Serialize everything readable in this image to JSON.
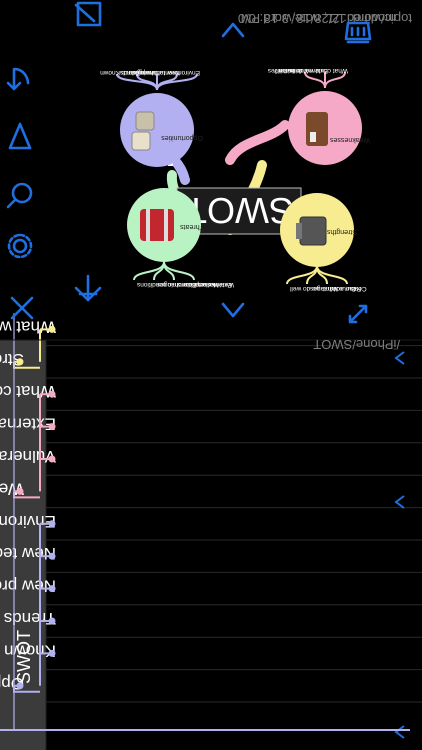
{
  "header": {
    "title": "SWOT"
  },
  "outline": {
    "items": [
      {
        "label": "Opportunities",
        "level": 1,
        "branch": "purple"
      },
      {
        "label": "Known",
        "level": 2,
        "branch": "purple"
      },
      {
        "label": "Trends",
        "level": 2,
        "branch": "purple"
      },
      {
        "label": "New products",
        "level": 2,
        "branch": "purple"
      },
      {
        "label": "New technologies",
        "level": 2,
        "branch": "purple"
      },
      {
        "label": "Environmental changes",
        "level": 2,
        "branch": "purple"
      },
      {
        "label": "Weaknesses",
        "level": 1,
        "branch": "pink"
      },
      {
        "label": "Vulnerabilities",
        "level": 2,
        "branch": "pink"
      },
      {
        "label": "External criticism",
        "level": 2,
        "branch": "pink"
      },
      {
        "label": "What could we do better?",
        "level": 2,
        "branch": "pink"
      },
      {
        "label": "Strengths",
        "level": 1,
        "branch": "yellow"
      },
      {
        "label": "What we do well",
        "level": 2,
        "branch": "yellow"
      }
    ]
  },
  "map": {
    "central": "SWOT",
    "nodes": {
      "opportunities": {
        "label": "Opportunities",
        "leaves": [
          "Known",
          "Trends",
          "New products",
          "New technologies",
          "Environmental changes"
        ]
      },
      "weaknesses": {
        "label": "Weaknesses",
        "leaves": [
          "Vulnerabilities",
          "External criticism",
          "What could we do better?"
        ]
      },
      "threats": {
        "label": "Threats",
        "leaves": [
          "Economic conditions",
          "Marketplace changes",
          "External conditions",
          "Weaknesses"
        ]
      },
      "strengths": {
        "label": "Strengths",
        "leaves": [
          "What we do well",
          "Our advantages",
          "Resources",
          "Costs"
        ]
      }
    }
  },
  "status": {
    "stats": "topic/word: 1/1, note/word: 0/0",
    "modified": "modified: 2/28/18, 3:13 PM",
    "path": "/iPhone/SWOT"
  },
  "colors": {
    "accent": "#1f6fe0",
    "purple": "#b2b0f0",
    "pink": "#f6a9c6",
    "yellow": "#f7ec8f",
    "green": "#b9f3c4",
    "header_bg": "#3b3b3b"
  },
  "icons": [
    "chevron-right-icon",
    "close-icon",
    "gear-icon",
    "search-icon",
    "filter-icon",
    "undo-icon",
    "edit-icon",
    "back-icon",
    "chevron-down-icon",
    "expand-icon",
    "trash-icon"
  ]
}
